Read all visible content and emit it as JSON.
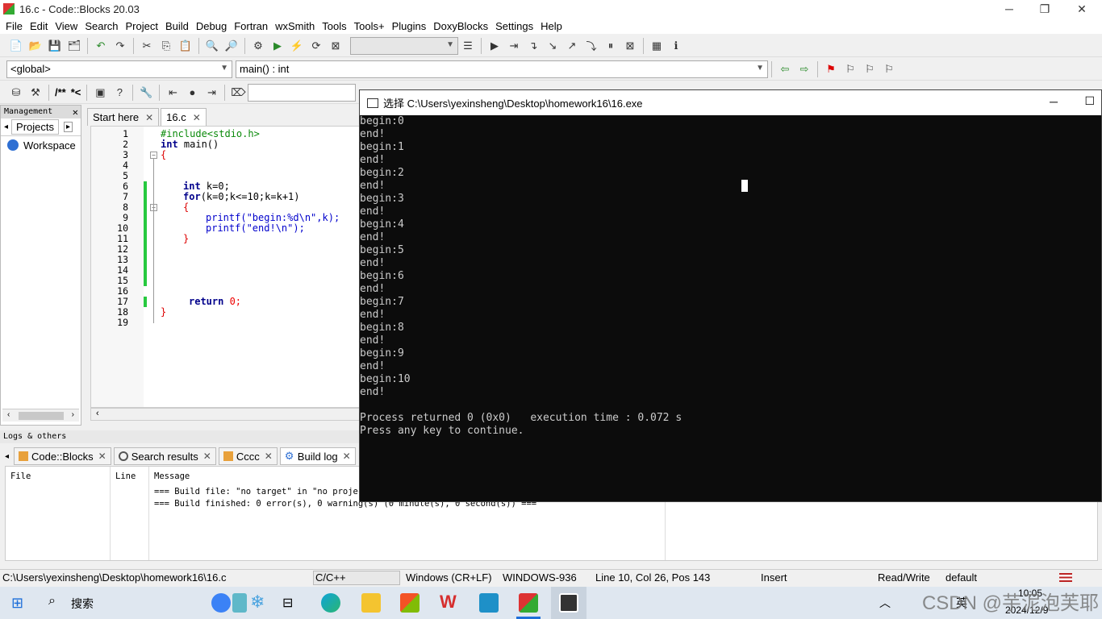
{
  "window": {
    "title": "16.c - Code::Blocks 20.03"
  },
  "menu": [
    "File",
    "Edit",
    "View",
    "Search",
    "Project",
    "Build",
    "Debug",
    "Fortran",
    "wxSmith",
    "Tools",
    "Tools+",
    "Plugins",
    "DoxyBlocks",
    "Settings",
    "Help"
  ],
  "toolbar": {
    "scope_combo": "<global>",
    "symbol_combo": "main() : int",
    "comment_block": "/**",
    "comment_line": "*<"
  },
  "management": {
    "header": "Management",
    "tab": "Projects",
    "workspace": "Workspace"
  },
  "editor": {
    "tabs": [
      {
        "label": "Start here"
      },
      {
        "label": "16.c"
      }
    ],
    "line_numbers": [
      "1",
      "2",
      "3",
      "4",
      "5",
      "6",
      "7",
      "8",
      "9",
      "10",
      "11",
      "12",
      "13",
      "14",
      "15",
      "16",
      "17",
      "18",
      "19"
    ],
    "code": {
      "l1": "#include<stdio.h>",
      "l2_kw": "int",
      "l2_rest": " main()",
      "l3": "{",
      "l6_kw": "int",
      "l6_rest": " k=0;",
      "l7_kw": "for",
      "l7_rest": "(k=0;k<=10;k=k+1)",
      "l8": "{",
      "l9": "printf(\"begin:%d\\n\",k);",
      "l10": "printf(\"end!\\n\");",
      "l11": "}",
      "l17_kw": "return",
      "l17_rest": " 0;",
      "l18": "}"
    }
  },
  "console": {
    "title": "选择 C:\\Users\\yexinsheng\\Desktop\\homework16\\16.exe",
    "lines": [
      "begin:0",
      "end!",
      "begin:1",
      "end!",
      "begin:2",
      "end!",
      "begin:3",
      "end!",
      "begin:4",
      "end!",
      "begin:5",
      "end!",
      "begin:6",
      "end!",
      "begin:7",
      "end!",
      "begin:8",
      "end!",
      "begin:9",
      "end!",
      "begin:10",
      "end!",
      "",
      "Process returned 0 (0x0)   execution time : 0.072 s",
      "Press any key to continue."
    ]
  },
  "logs": {
    "header": "Logs & others",
    "tabs": [
      "Code::Blocks",
      "Search results",
      "Cccc",
      "Build log"
    ],
    "columns": [
      "File",
      "Line",
      "Message"
    ],
    "messages": [
      "=== Build file: \"no target\" in \"no project\"",
      "=== Build finished: 0 error(s), 0 warning(s) (0 minute(s), 0 second(s)) ==="
    ]
  },
  "status": {
    "path": "C:\\Users\\yexinsheng\\Desktop\\homework16\\16.c",
    "language": "C/C++",
    "eol": "Windows (CR+LF)",
    "encoding": "WINDOWS-936",
    "position": "Line 10, Col 26, Pos 143",
    "mode": "Insert",
    "access": "Read/Write",
    "profile": "default"
  },
  "taskbar": {
    "search": "搜索",
    "ime": "英",
    "time": "10:05",
    "date": "2024/12/9",
    "watermark": "CSDN @芋泥泡芙耶"
  }
}
